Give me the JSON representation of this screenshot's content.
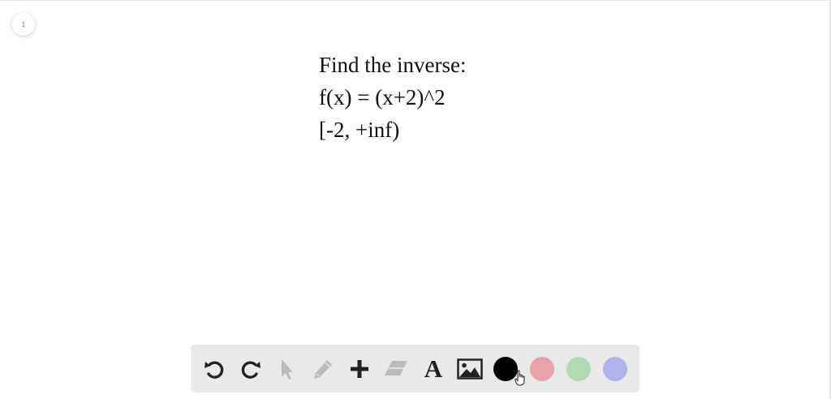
{
  "page": {
    "number": "1"
  },
  "problem": {
    "line1": "Find the inverse:",
    "line2": "f(x) = (x+2)^2",
    "line3": "[-2, +inf)"
  },
  "toolbar": {
    "tools": [
      {
        "name": "undo",
        "icon": "undo-icon",
        "enabled": true
      },
      {
        "name": "redo",
        "icon": "redo-icon",
        "enabled": true
      },
      {
        "name": "select",
        "icon": "pointer-icon",
        "enabled": false
      },
      {
        "name": "pen",
        "icon": "pencil-icon",
        "enabled": false
      },
      {
        "name": "add",
        "icon": "plus-icon",
        "enabled": true
      },
      {
        "name": "eraser",
        "icon": "eraser-icon",
        "enabled": false
      },
      {
        "name": "text",
        "icon": "text-icon",
        "label": "A",
        "enabled": true
      },
      {
        "name": "image",
        "icon": "image-icon",
        "enabled": true
      }
    ],
    "colors": [
      {
        "name": "black",
        "hex": "#000000",
        "selected": true
      },
      {
        "name": "red",
        "hex": "#e7a3aa",
        "selected": false
      },
      {
        "name": "green",
        "hex": "#b3d9b5",
        "selected": false
      },
      {
        "name": "blue",
        "hex": "#b1b1ec",
        "selected": false
      }
    ]
  }
}
